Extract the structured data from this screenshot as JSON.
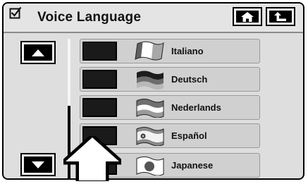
{
  "header": {
    "title": "Voice  Language",
    "home_icon": "home-icon",
    "back_icon": "return-arrow-icon",
    "check_icon": "checkbox-checked-icon"
  },
  "scroll": {
    "up_icon": "triangle-up-icon",
    "down_icon": "triangle-down-icon"
  },
  "languages": [
    {
      "label": "Italiano",
      "flag": "italy-flag-icon"
    },
    {
      "label": "Deutsch",
      "flag": "germany-flag-icon"
    },
    {
      "label": "Nederlands",
      "flag": "netherlands-flag-icon"
    },
    {
      "label": "Español",
      "flag": "spain-flag-icon"
    },
    {
      "label": "Japanese",
      "flag": "japan-flag-icon"
    }
  ],
  "overlay": {
    "pointer_icon": "up-arrow-pointer-icon"
  }
}
